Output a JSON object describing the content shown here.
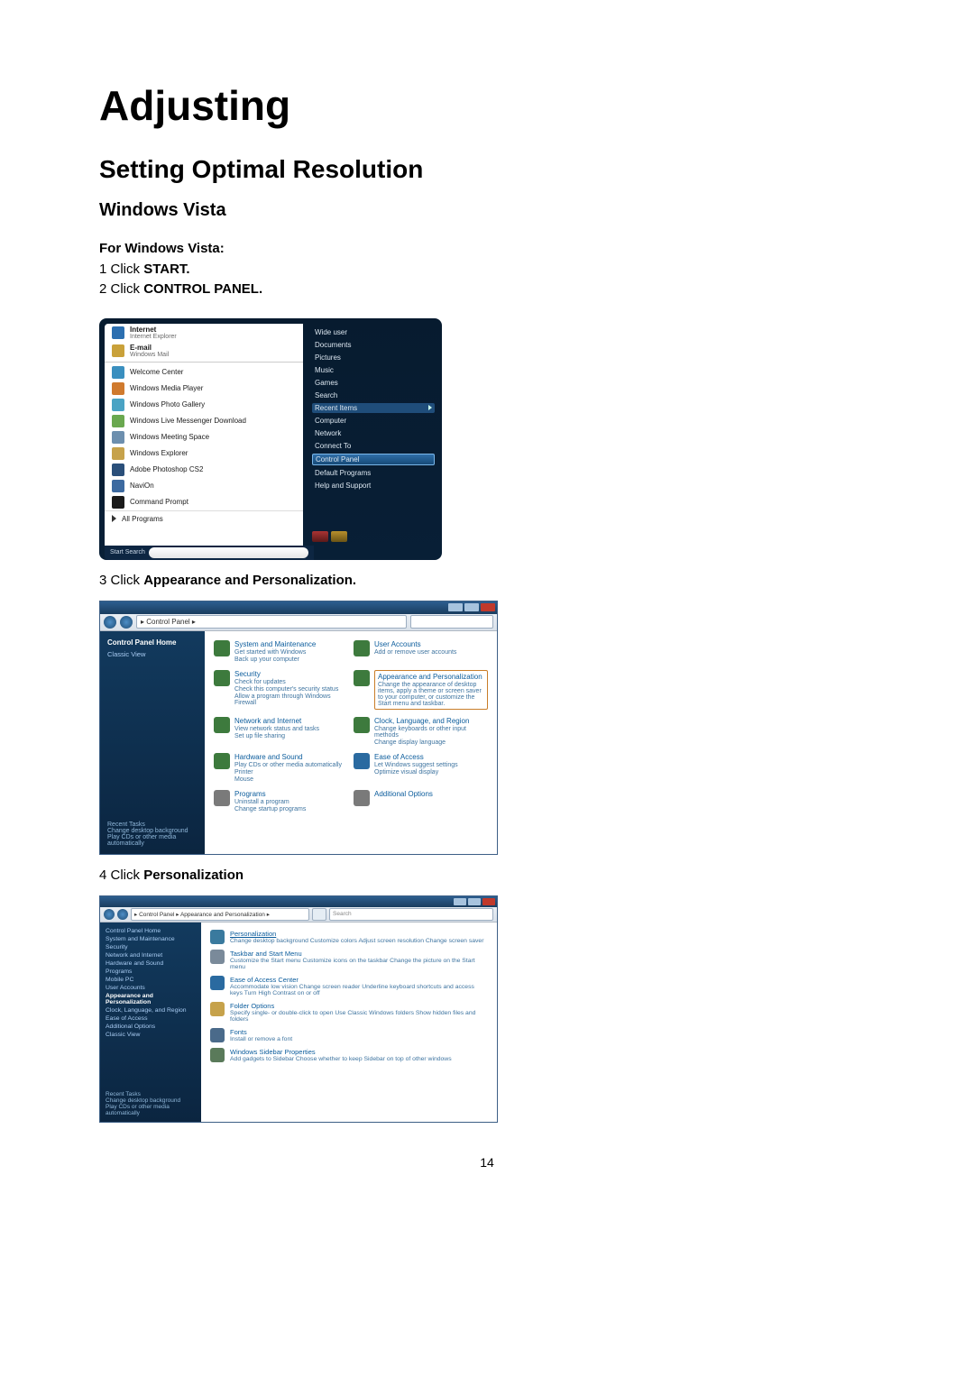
{
  "page_number": "14",
  "h1": "Adjusting",
  "h2": "Setting Optimal Resolution",
  "h3": "Windows Vista",
  "intro": {
    "line0": "For Windows Vista:",
    "line1a": "1 Click ",
    "line1b": "START.",
    "line2a": "2 Click ",
    "line2b": "CONTROL PANEL."
  },
  "step3a": "3 Click ",
  "step3b": "Appearance and Personalization.",
  "step4a": "4 Click ",
  "step4b": "Personalization",
  "startmenu": {
    "pinned": [
      {
        "name": "Internet",
        "sub": "Internet Explorer",
        "color": "#2c6fb0"
      },
      {
        "name": "E-mail",
        "sub": "Windows Mail",
        "color": "#c9a13a"
      }
    ],
    "recent": [
      {
        "name": "Welcome Center",
        "color": "#3a8fbf"
      },
      {
        "name": "Windows Media Player",
        "color": "#d07a2e"
      },
      {
        "name": "Windows Photo Gallery",
        "color": "#4aa3c4"
      },
      {
        "name": "Windows Live Messenger Download",
        "color": "#6aa84f"
      },
      {
        "name": "Windows Meeting Space",
        "color": "#6d8fae"
      },
      {
        "name": "Windows Explorer",
        "color": "#c6a24b"
      },
      {
        "name": "Adobe Photoshop CS2",
        "color": "#2a4f7a"
      },
      {
        "name": "NaviOn",
        "color": "#3d6aa0"
      },
      {
        "name": "Command Prompt",
        "color": "#1a1a1a"
      }
    ],
    "all_programs": "All Programs",
    "search_label": "Start Search",
    "right": [
      "Wide user",
      "Documents",
      "Pictures",
      "Music",
      "Games",
      "Search",
      "Recent Items",
      "Computer",
      "Network",
      "Connect To",
      "Control Panel",
      "Default Programs",
      "Help and Support"
    ]
  },
  "cp": {
    "breadcrumb": " ▸ Control Panel ▸",
    "side_header": "Control Panel Home",
    "side_link": "Classic View",
    "recent_header": "Recent Tasks",
    "recent1": "Change desktop background",
    "recent2": "Play CDs or other media automatically",
    "cats": [
      {
        "title": "System and Maintenance",
        "sub": "Get started with Windows\nBack up your computer",
        "color": "#3d7a3d"
      },
      {
        "title": "User Accounts",
        "sub": "Add or remove user accounts",
        "color": "#3d7a3d"
      },
      {
        "title": "Security",
        "sub": "Check for updates\nCheck this computer's security status\nAllow a program through Windows Firewall",
        "color": "#3d7a3d"
      },
      {
        "title": "Appearance and Personalization",
        "sub": "Change the appearance of desktop items, apply a theme or screen saver to your computer, or customize the Start menu and taskbar.",
        "color": "#3d7a3d",
        "highlight": true
      },
      {
        "title": "Network and Internet",
        "sub": "View network status and tasks\nSet up file sharing",
        "color": "#3d7a3d"
      },
      {
        "title": "Clock, Language, and Region",
        "sub": "Change keyboards or other input methods\nChange display language",
        "color": "#3d7a3d"
      },
      {
        "title": "Hardware and Sound",
        "sub": "Play CDs or other media automatically\nPrinter\nMouse",
        "color": "#3d7a3d"
      },
      {
        "title": "Ease of Access",
        "sub": "Let Windows suggest settings\nOptimize visual display",
        "color": "#2a6aa0"
      },
      {
        "title": "Programs",
        "sub": "Uninstall a program\nChange startup programs",
        "color": "#7a7a7a"
      },
      {
        "title": "Additional Options",
        "sub": "",
        "color": "#7a7a7a"
      }
    ]
  },
  "ap": {
    "breadcrumb": " ▸ Control Panel ▸ Appearance and Personalization ▸",
    "search_placeholder": "Search",
    "side": [
      "Control Panel Home",
      "System and Maintenance",
      "Security",
      "Network and Internet",
      "Hardware and Sound",
      "Programs",
      "Mobile PC",
      "User Accounts",
      "Appearance and Personalization",
      "Clock, Language, and Region",
      "Ease of Access",
      "Additional Options"
    ],
    "side_extra": "Classic View",
    "recent_header": "Recent Tasks",
    "recent1": "Change desktop background",
    "recent2": "Play CDs or other media automatically",
    "entries": [
      {
        "title": "Personalization",
        "links": "Change desktop background   Customize colors   Adjust screen resolution   Change screen saver",
        "color": "#3a7a9e",
        "highlight": true
      },
      {
        "title": "Taskbar and Start Menu",
        "links": "Customize the Start menu   Customize icons on the taskbar   Change the picture on the Start menu",
        "color": "#7a8a9a"
      },
      {
        "title": "Ease of Access Center",
        "links": "Accommodate low vision   Change screen reader   Underline keyboard shortcuts and access keys   Turn High Contrast on or off",
        "color": "#2a6aa0"
      },
      {
        "title": "Folder Options",
        "links": "Specify single- or double-click to open   Use Classic Windows folders   Show hidden files and folders",
        "color": "#c6a24b"
      },
      {
        "title": "Fonts",
        "links": "Install or remove a font",
        "color": "#4a6a8a"
      },
      {
        "title": "Windows Sidebar Properties",
        "links": "Add gadgets to Sidebar   Choose whether to keep Sidebar on top of other windows",
        "color": "#5a7a5a"
      }
    ]
  }
}
